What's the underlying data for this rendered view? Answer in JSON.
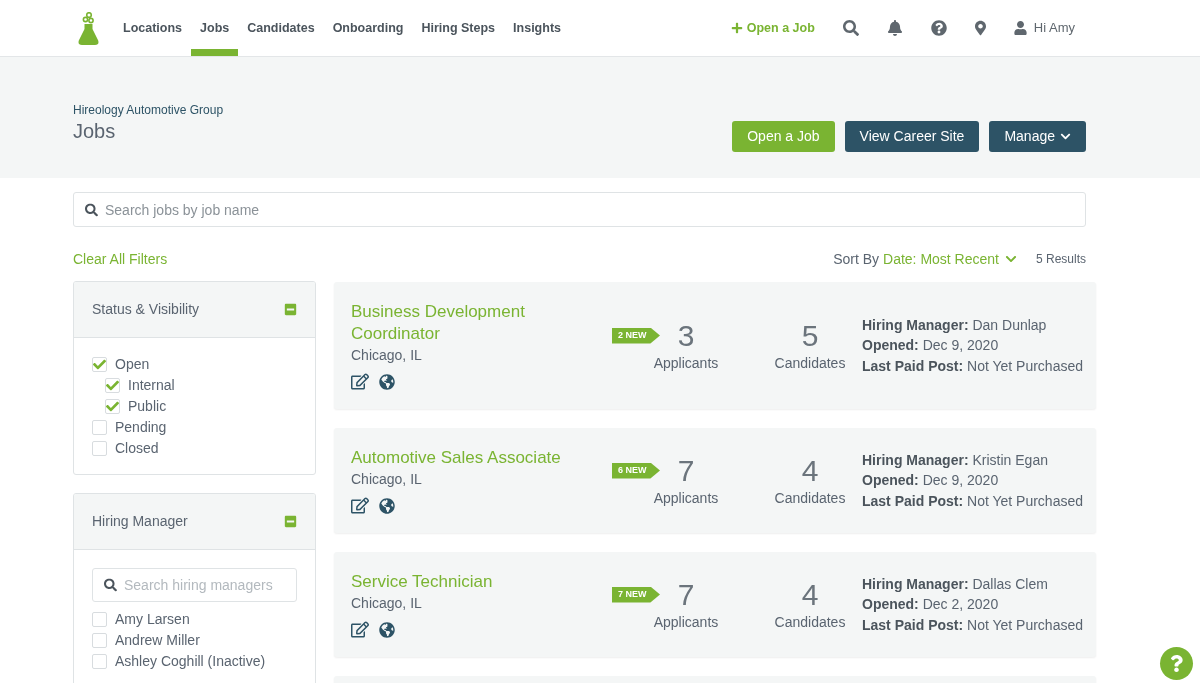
{
  "nav": {
    "items": [
      {
        "label": "Locations",
        "selected": false
      },
      {
        "label": "Jobs",
        "selected": true
      },
      {
        "label": "Candidates",
        "selected": false
      },
      {
        "label": "Onboarding",
        "selected": false
      },
      {
        "label": "Hiring Steps",
        "selected": false
      },
      {
        "label": "Insights",
        "selected": false
      }
    ],
    "open_job": "Open a Job",
    "greeting": "Hi Amy"
  },
  "header": {
    "organization": "Hireology Automotive Group",
    "title": "Jobs",
    "buttons": [
      {
        "label": "Open a Job",
        "kind": "primary"
      },
      {
        "label": "View Career Site",
        "kind": "secondary"
      },
      {
        "label": "Manage",
        "kind": "dropdown"
      }
    ]
  },
  "search": {
    "placeholder": "Search jobs by job name"
  },
  "toolbar": {
    "clear_filters": "Clear All Filters",
    "sort_label": "Sort By",
    "sort_value": "Date: Most Recent",
    "results": "5 Results"
  },
  "filters": [
    {
      "title": "Status & Visibility",
      "expanded": true,
      "options": [
        {
          "label": "Open",
          "checked": true,
          "children": [
            {
              "label": "Internal",
              "checked": true
            },
            {
              "label": "Public",
              "checked": true
            }
          ]
        },
        {
          "label": "Pending",
          "checked": false
        },
        {
          "label": "Closed",
          "checked": false
        }
      ]
    },
    {
      "title": "Hiring Manager",
      "expanded": true,
      "search_placeholder": "Search hiring managers",
      "options": [
        {
          "label": "Amy Larsen",
          "checked": false
        },
        {
          "label": "Andrew Miller",
          "checked": false
        },
        {
          "label": "Ashley Coghill (Inactive)",
          "checked": false
        }
      ]
    }
  ],
  "jobs": [
    {
      "title": "Business Development Coordinator",
      "location": "Chicago, IL",
      "new_badge": "2 NEW",
      "applicants": "3",
      "applicants_label": "Applicants",
      "candidates": "5",
      "candidates_label": "Candidates",
      "details": [
        "**Hiring Manager:** Dan Dunlap",
        "**Opened:** Dec 9, 2020",
        "**Last Paid Post:** Not Yet Purchased"
      ]
    },
    {
      "title": "Automotive Sales Associate",
      "location": "Chicago, IL",
      "new_badge": "6 NEW",
      "applicants": "7",
      "applicants_label": "Applicants",
      "candidates": "4",
      "candidates_label": "Candidates",
      "details": [
        "**Hiring Manager:** Kristin Egan",
        "**Opened:** Dec 9, 2020",
        "**Last Paid Post:** Not Yet Purchased"
      ]
    },
    {
      "title": "Service Technician",
      "location": "Chicago, IL",
      "new_badge": "7 NEW",
      "applicants": "7",
      "applicants_label": "Applicants",
      "candidates": "4",
      "candidates_label": "Candidates",
      "details": [
        "**Hiring Manager:** Dallas Clem",
        "**Opened:** Dec 2, 2020",
        "**Last Paid Post:** Not Yet Purchased"
      ]
    }
  ]
}
